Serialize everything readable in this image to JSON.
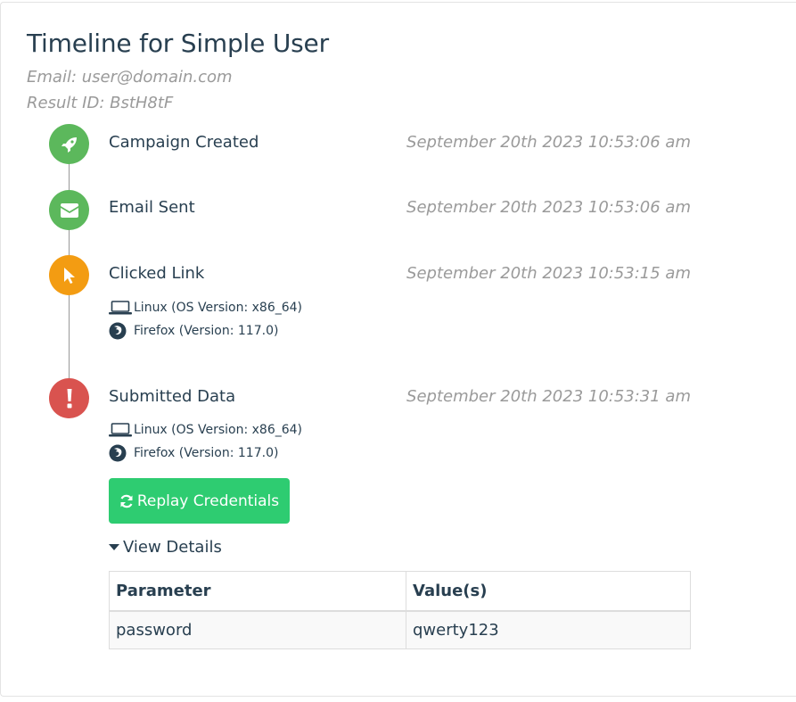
{
  "header": {
    "title": "Timeline for Simple User",
    "email": "Email: user@domain.com",
    "result_id": "Result ID: BstH8tF"
  },
  "colors": {
    "success": "#5cb85c",
    "warning": "#f39c12",
    "danger": "#d9534f",
    "replay_button": "#2ecc71"
  },
  "events": [
    {
      "title": "Campaign Created",
      "date": "September 20th 2023 10:53:06 am",
      "icon": "rocket-icon"
    },
    {
      "title": "Email Sent",
      "date": "September 20th 2023 10:53:06 am",
      "icon": "envelope-icon"
    },
    {
      "title": "Clicked Link",
      "date": "September 20th 2023 10:53:15 am",
      "icon": "mouse-pointer-icon",
      "os": "Linux (OS Version: x86_64)",
      "browser": "Firefox (Version: 117.0)"
    },
    {
      "title": "Submitted Data",
      "date": "September 20th 2023 10:53:31 am",
      "icon": "exclamation-icon",
      "os": "Linux (OS Version: x86_64)",
      "browser": "Firefox (Version: 117.0)"
    }
  ],
  "replay_button": "Replay Credentials",
  "view_details": "View Details",
  "table": {
    "headers": [
      "Parameter",
      "Value(s)"
    ],
    "rows": [
      [
        "password",
        "qwerty123"
      ]
    ]
  }
}
